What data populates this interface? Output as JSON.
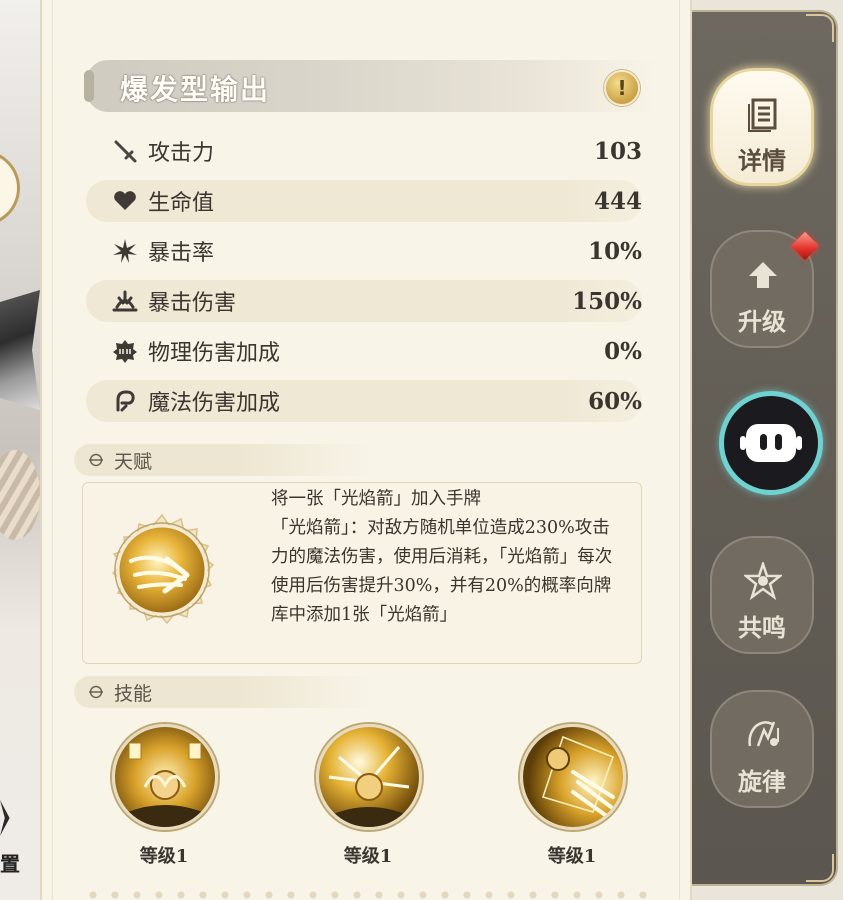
{
  "character_panel": {
    "title": "爆发型输出",
    "stats": [
      {
        "icon": "sword-icon",
        "label": "攻击力",
        "value": "103"
      },
      {
        "icon": "heart-icon",
        "label": "生命值",
        "value": "444"
      },
      {
        "icon": "burst-star-icon",
        "label": "暴击率",
        "value": "10%"
      },
      {
        "icon": "impact-icon",
        "label": "暴击伤害",
        "value": "150%"
      },
      {
        "icon": "physical-damage-icon",
        "label": "物理伤害加成",
        "value": "0%"
      },
      {
        "icon": "magic-damage-icon",
        "label": "魔法伤害加成",
        "value": "60%"
      }
    ],
    "talent": {
      "section_title": "天赋",
      "description_line1": "将一张「光焰箭」加入手牌",
      "description_line2": "「光焰箭」：对敌方随机单位造成230%攻击力的魔法伤害，使用后消耗，「光焰箭」每次使用后伤害提升30%，并有20%的概率向牌库中添加1张「光焰箭」"
    },
    "skills": {
      "section_title": "技能",
      "items": [
        {
          "level_label": "等级1"
        },
        {
          "level_label": "等级1"
        },
        {
          "level_label": "等级1"
        }
      ]
    }
  },
  "sidebar": {
    "tabs": [
      {
        "label": "详情",
        "icon": "details-icon",
        "active": true
      },
      {
        "label": "升级",
        "icon": "upgrade-arrow-icon",
        "active": false,
        "badge": "red-gem-icon"
      },
      {
        "label": "共鸣",
        "icon": "resonance-icon",
        "active": false
      },
      {
        "label": "旋律",
        "icon": "melody-icon",
        "active": false
      }
    ]
  },
  "left_edge": {
    "partial_text": "置"
  },
  "colors": {
    "panel_bg": "#f8f4e7",
    "text_dark": "#3b3530",
    "gold": "#caa246",
    "sidebar_bg": "#625d55",
    "assistant_ring": "#6fd2d0"
  }
}
